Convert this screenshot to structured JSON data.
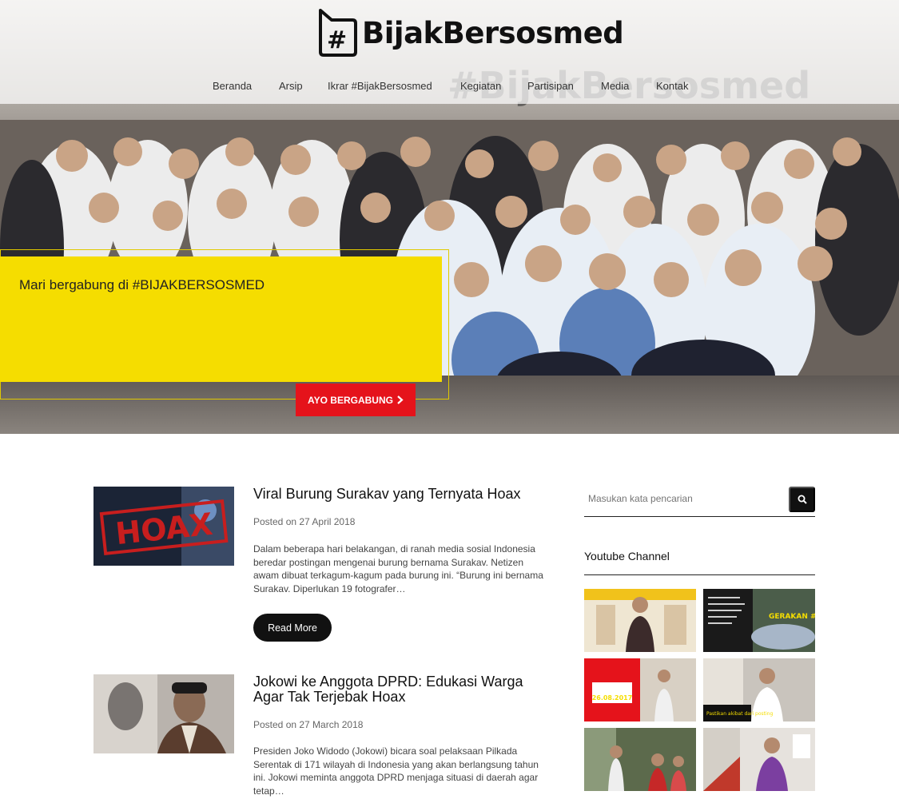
{
  "brand": {
    "name": "BijakBersosmed",
    "hash": "#"
  },
  "nav": [
    {
      "label": "Beranda"
    },
    {
      "label": "Arsip"
    },
    {
      "label": "Ikrar #BijakBersosmed"
    },
    {
      "label": "Kegiatan"
    },
    {
      "label": "Partisipan"
    },
    {
      "label": "Media"
    },
    {
      "label": "Kontak"
    }
  ],
  "hero": {
    "title": "Mari bergabung di #BIJAKBERSOSMED",
    "button_label": "AYO BERGABUNG",
    "button_icon": "chevron-right-icon",
    "background_banner_text": "#BijakBersosmed"
  },
  "posts": [
    {
      "title": "Viral Burung Surakav yang Ternyata Hoax",
      "date": "Posted on 27 April 2018",
      "excerpt": "Dalam beberapa hari belakangan, di ranah media sosial Indonesia beredar postingan mengenai burung bernama Surakav. Netizen awam dibuat terkagum-kagum pada burung ini. “Burung ini bernama Surakav. Diperlukan 19 fotografer…",
      "read_more": "Read More",
      "thumb_text": "HOAX"
    },
    {
      "title": "Jokowi ke Anggota DPRD: Edukasi Warga Agar Tak Terjebak Hoax",
      "date": "Posted on 27 March 2018",
      "excerpt": "Presiden Joko Widodo (Jokowi) bicara soal pelaksaan Pilkada Serentak di 171 wilayah di Indonesia yang akan berlangsung tahun ini. Jokowi meminta anggota DPRD menjaga situasi di daerah agar tetap…"
    }
  ],
  "sidebar": {
    "search_placeholder": "Masukan kata pencarian",
    "search_icon": "search-icon",
    "youtube_title": "Youtube Channel",
    "videos": [
      {
        "caption": ""
      },
      {
        "caption": "GERAKAN #BijakBersosmed"
      },
      {
        "caption": "26.08.2017"
      },
      {
        "caption": "Pastikan akibat dari posting"
      },
      {
        "caption": ""
      },
      {
        "caption": ""
      }
    ]
  },
  "colors": {
    "accent_yellow": "#f5dd00",
    "accent_red": "#e5131b",
    "dark": "#111111"
  }
}
